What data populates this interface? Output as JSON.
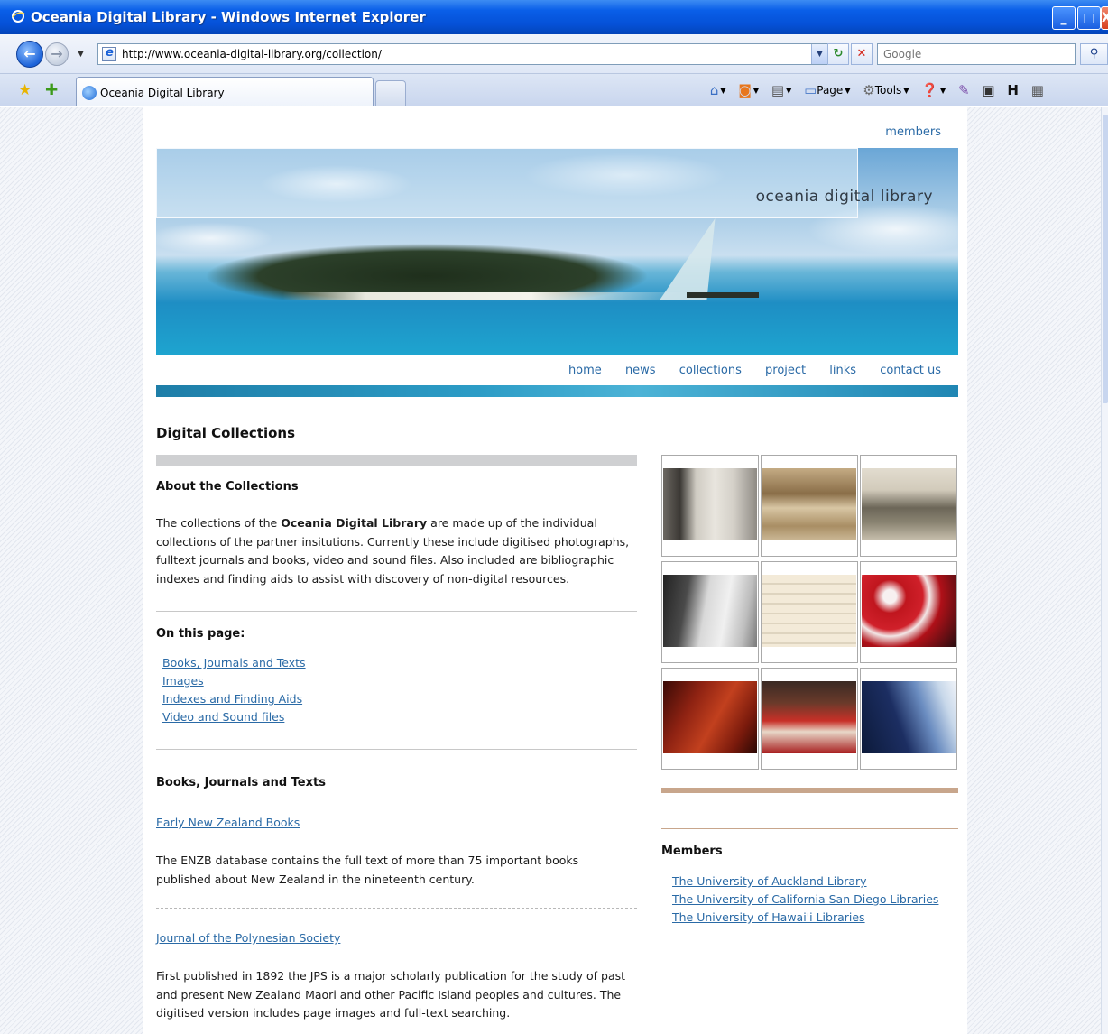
{
  "window": {
    "title": "Oceania Digital Library - Windows Internet Explorer",
    "min_glyph": "_",
    "max_glyph": "□",
    "close_glyph": "X"
  },
  "address": {
    "url": "http://www.oceania-digital-library.org/collection/",
    "search_placeholder": "Google"
  },
  "tab": {
    "label": "Oceania Digital Library"
  },
  "command_bar": {
    "page": "Page",
    "tools": "Tools"
  },
  "site": {
    "members_link": "members",
    "title": "oceania digital library",
    "nav": [
      "home",
      "news",
      "collections",
      "project",
      "links",
      "contact us"
    ]
  },
  "content": {
    "heading": "Digital Collections",
    "about": {
      "heading": "About the Collections",
      "text_pre": "The collections of the ",
      "text_bold": "Oceania Digital Library",
      "text_post": " are made up of the individual collections of the partner insitutions. Currently these include digitised photographs, fulltext journals and books, video and sound files. Also included are bibliographic indexes and finding aids to assist with discovery of non-digital resources."
    },
    "on_this_page": {
      "heading": "On this page:",
      "links": [
        "Books, Journals and Texts",
        "Images",
        "Indexes and Finding Aids",
        "Video and Sound files"
      ]
    },
    "books": {
      "heading": "Books, Journals and Texts",
      "items": [
        {
          "link": "Early New Zealand Books",
          "text": "The ENZB database contains the full text of more than 75 important books published about New Zealand in the nineteenth century."
        },
        {
          "link": "Journal of the Polynesian Society",
          "text": "First published in 1892 the JPS is a major scholarly publication for the study of past and present New Zealand Maori and other Pacific Island peoples and cultures. The digitised version includes page images and full-text searching."
        }
      ]
    }
  },
  "sidebar": {
    "members_heading": "Members",
    "members": [
      "The University of Auckland Library",
      "The University of California San Diego Libraries",
      "The University of Hawai'i Libraries"
    ]
  },
  "colors": {
    "link": "#2a6aa6",
    "title_bar": "#0551d8",
    "accent_rule": "#c8a68c"
  }
}
